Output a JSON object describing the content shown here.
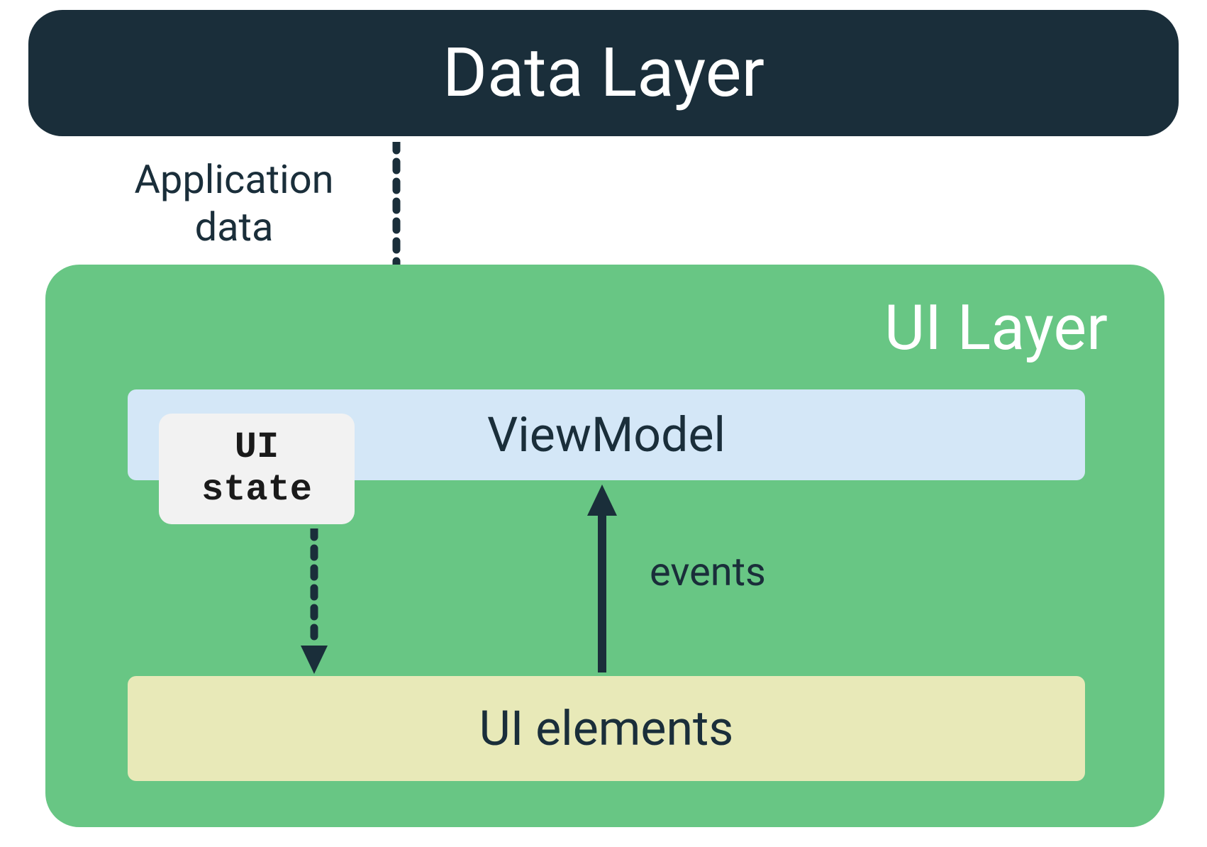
{
  "dataLayer": {
    "title": "Data Layer"
  },
  "arrows": {
    "appDataLabel": "Application\ndata",
    "eventsLabel": "events"
  },
  "uiLayer": {
    "title": "UI Layer",
    "viewModel": "ViewModel",
    "uiState": "UI\nstate",
    "uiElements": "UI elements"
  },
  "colors": {
    "darkNavy": "#1a2e3a",
    "green": "#68c684",
    "lightBlue": "#d4e7f7",
    "paleYellow": "#e8e9b8",
    "lightGray": "#f2f2f2"
  }
}
